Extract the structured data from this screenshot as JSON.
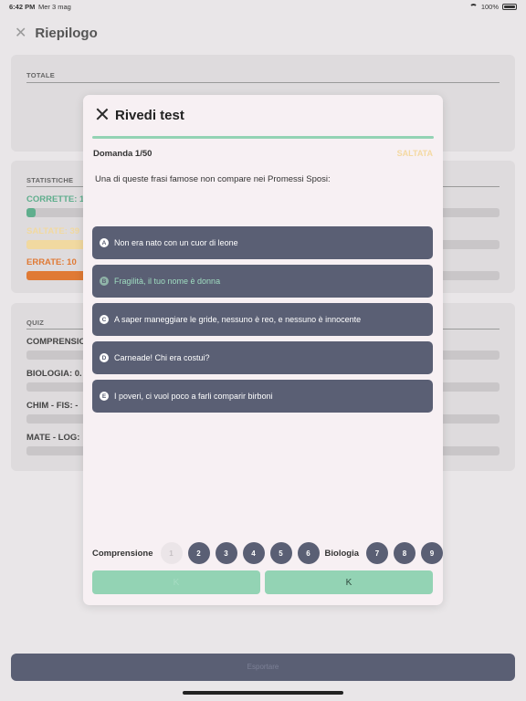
{
  "status_bar": {
    "time": "6:42 PM",
    "date": "Mer 3 mag",
    "battery": "100%"
  },
  "background": {
    "title": "Riepilogo",
    "totale_label": "TOTALE",
    "statistiche_label": "STATISTICHE",
    "stats": [
      {
        "label": "CORRETTE: 1",
        "color": "#5fae8d",
        "fraction": 0.02
      },
      {
        "label": "SALTATE: 39",
        "color": "#f1d9a0",
        "fraction": 0.78
      },
      {
        "label": "ERRATE: 10",
        "color": "#e07a35",
        "fraction": 0.2
      }
    ],
    "quiz_label": "QUIZ",
    "quiz_rows": [
      {
        "label": "COMPRENSIO"
      },
      {
        "label": "BIOLOGIA: 0."
      },
      {
        "label": "CHIM - FIS: -"
      },
      {
        "label": "MATE - LOG:"
      }
    ],
    "bottom_button": "Esportare"
  },
  "modal": {
    "title": "Rivedi test",
    "question_number": "Domanda 1/50",
    "status": "SALTATA",
    "question": "Una di queste frasi famose non compare nei Promessi Sposi:",
    "answers": [
      {
        "letter": "A",
        "text": "Non era nato con un cuor di leone",
        "correct": false
      },
      {
        "letter": "B",
        "text": "Fragilità, il tuo nome è donna",
        "correct": true
      },
      {
        "letter": "C",
        "text": "A saper maneggiare le gride, nessuno è reo, e nessuno è innocente",
        "correct": false
      },
      {
        "letter": "D",
        "text": "Carneade! Chi era costui?",
        "correct": false
      },
      {
        "letter": "E",
        "text": "I poveri, ci vuol poco a farli comparir birboni",
        "correct": false
      }
    ],
    "nav": {
      "section1": "Comprensione",
      "section1_numbers": [
        "1",
        "2",
        "3",
        "4",
        "5",
        "6"
      ],
      "section2": "Biologia",
      "section2_numbers": [
        "7",
        "8",
        "9"
      ],
      "prev_label": "K",
      "next_label": "K"
    },
    "colors": {
      "accent": "#93d3b4",
      "answer_bg": "#5a5f74",
      "skipped": "#f4d9a2"
    }
  }
}
